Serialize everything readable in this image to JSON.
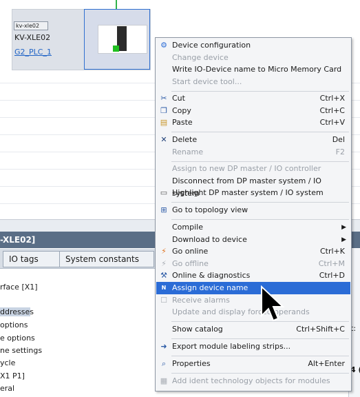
{
  "canvas": {
    "device": {
      "tag": "kv-xle02",
      "name": "KV-XLE02",
      "link": "G2_PLC_1"
    }
  },
  "inspector": {
    "title": "-XLE02]",
    "tabs": [
      "IO tags",
      "System constants"
    ],
    "tree": [
      "rface [X1]",
      "ddresses",
      "options",
      "e options",
      "ne settings",
      "ycle",
      "X1 P1]",
      "eral"
    ],
    "right_fragment": "t:",
    "right_fragment2": "4 ("
  },
  "menu": {
    "items": [
      {
        "label": "Device configuration",
        "shortcut": "",
        "icon": "device-config-icon",
        "glyph": "⚙",
        "disabled": false
      },
      {
        "label": "Change device",
        "shortcut": "",
        "icon": "",
        "glyph": "",
        "disabled": true
      },
      {
        "label": "Write IO-Device name to Micro Memory Card",
        "shortcut": "",
        "icon": "",
        "glyph": "",
        "disabled": false
      },
      {
        "label": "Start device tool...",
        "shortcut": "",
        "icon": "",
        "glyph": "",
        "disabled": true
      },
      {
        "label": "Cut",
        "shortcut": "Ctrl+X",
        "icon": "scissors-icon",
        "glyph": "✂",
        "disabled": false
      },
      {
        "label": "Copy",
        "shortcut": "Ctrl+C",
        "icon": "copy-icon",
        "glyph": "❐",
        "disabled": false
      },
      {
        "label": "Paste",
        "shortcut": "Ctrl+V",
        "icon": "paste-icon",
        "glyph": "📋",
        "disabled": false
      },
      {
        "label": "Delete",
        "shortcut": "Del",
        "icon": "delete-x-icon",
        "glyph": "✕",
        "disabled": false
      },
      {
        "label": "Rename",
        "shortcut": "F2",
        "icon": "",
        "glyph": "",
        "disabled": true
      },
      {
        "label": "Assign to new DP master / IO controller",
        "shortcut": "",
        "icon": "",
        "glyph": "",
        "disabled": true
      },
      {
        "label": "Disconnect from DP master system / IO system",
        "shortcut": "",
        "icon": "",
        "glyph": "",
        "disabled": false
      },
      {
        "label": "Highlight DP master system / IO system",
        "shortcut": "",
        "icon": "highlight-icon",
        "glyph": "▭",
        "disabled": false
      },
      {
        "label": "Go to topology view",
        "shortcut": "",
        "icon": "topology-icon",
        "glyph": "⊞",
        "disabled": false
      },
      {
        "label": "Compile",
        "shortcut": "",
        "icon": "",
        "glyph": "",
        "disabled": false,
        "submenu": true
      },
      {
        "label": "Download to device",
        "shortcut": "",
        "icon": "",
        "glyph": "",
        "disabled": false,
        "submenu": true
      },
      {
        "label": "Go online",
        "shortcut": "Ctrl+K",
        "icon": "go-online-icon",
        "glyph": "⚡",
        "disabled": false
      },
      {
        "label": "Go offline",
        "shortcut": "Ctrl+M",
        "icon": "go-offline-icon",
        "glyph": "⚡",
        "disabled": true
      },
      {
        "label": "Online & diagnostics",
        "shortcut": "Ctrl+D",
        "icon": "diagnostics-icon",
        "glyph": "🔧",
        "disabled": false
      },
      {
        "label": "Assign device name",
        "shortcut": "",
        "icon": "name-tag-icon",
        "glyph": "N",
        "disabled": false,
        "highlighted": true
      },
      {
        "label": "Receive alarms",
        "shortcut": "",
        "icon": "alarm-checkbox-icon",
        "glyph": "☐",
        "disabled": true
      },
      {
        "label": "Update and display forced operands",
        "shortcut": "",
        "icon": "",
        "glyph": "",
        "disabled": true
      },
      {
        "label": "Show catalog",
        "shortcut": "Ctrl+Shift+C",
        "icon": "",
        "glyph": "",
        "disabled": false
      },
      {
        "label": "Export module labeling strips...",
        "shortcut": "",
        "icon": "export-icon",
        "glyph": "➜",
        "disabled": false
      },
      {
        "label": "Properties",
        "shortcut": "Alt+Enter",
        "icon": "properties-icon",
        "glyph": "🔍",
        "disabled": false
      },
      {
        "label": "Add ident technology objects for modules",
        "shortcut": "",
        "icon": "ident-icon",
        "glyph": "▦",
        "disabled": true
      }
    ]
  },
  "colors": {
    "highlight": "#2b6cd6",
    "accent_green": "#2fb34a",
    "title_bar": "#5a6e86"
  }
}
